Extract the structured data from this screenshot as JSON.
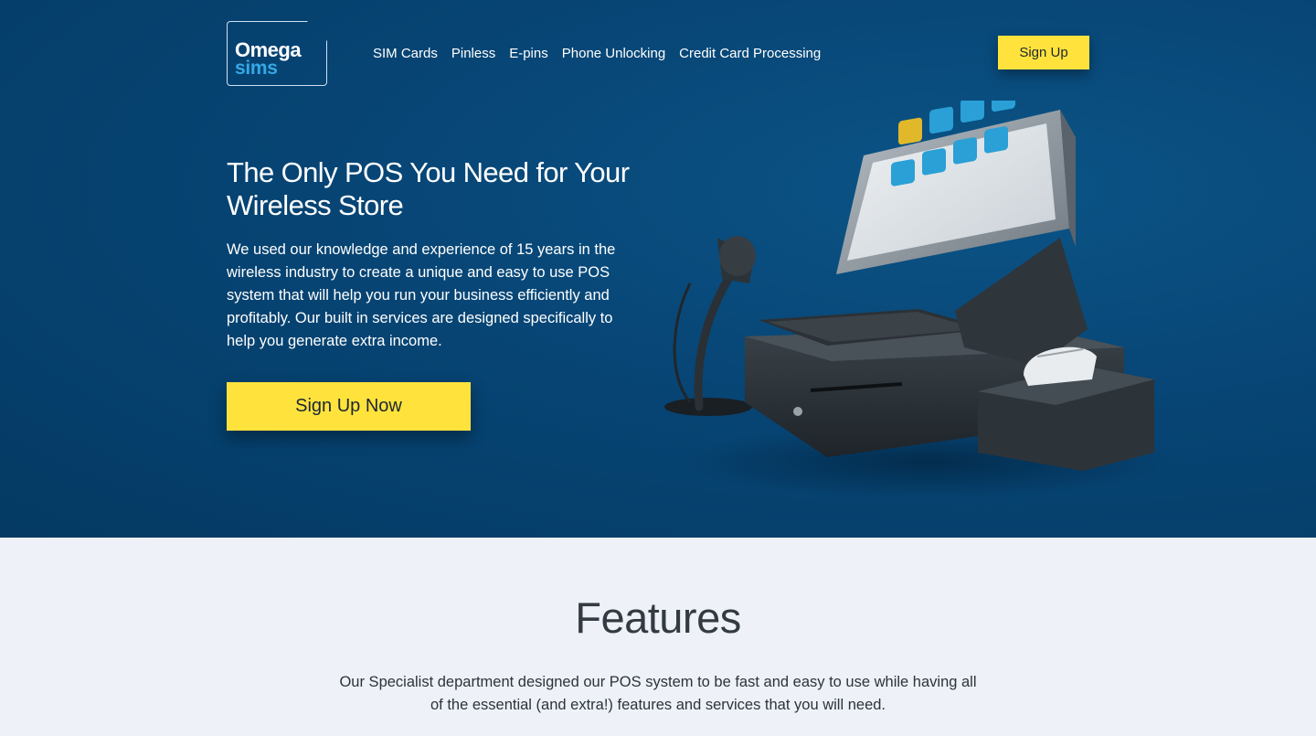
{
  "brand": {
    "line1": "Omega",
    "line2": "sims",
    "colors": {
      "hero_bg": "#074575",
      "accent_yellow": "#ffe33c",
      "logo_blue": "#35a8e6",
      "section_bg": "#eef2f8"
    }
  },
  "nav": {
    "items": [
      {
        "label": "SIM Cards"
      },
      {
        "label": "Pinless"
      },
      {
        "label": "E-pins"
      },
      {
        "label": "Phone Unlocking"
      },
      {
        "label": "Credit Card Processing"
      }
    ],
    "signup_label": "Sign Up"
  },
  "hero": {
    "title": "The Only POS You Need for Your Wireless Store",
    "description": "We used our knowledge and experience of 15 years in the wireless industry to create a unique and easy to use POS system that will help you run your business efficiently and profitably. Our built in services are designed specifically to help you generate extra income.",
    "cta_label": "Sign Up Now",
    "illustration": "pos-terminal-with-scanner-cash-drawer-printer"
  },
  "features": {
    "title": "Features",
    "description": "Our Specialist department designed our POS system to be fast and easy to use while having all of the essential (and extra!) features and services that you will need."
  }
}
